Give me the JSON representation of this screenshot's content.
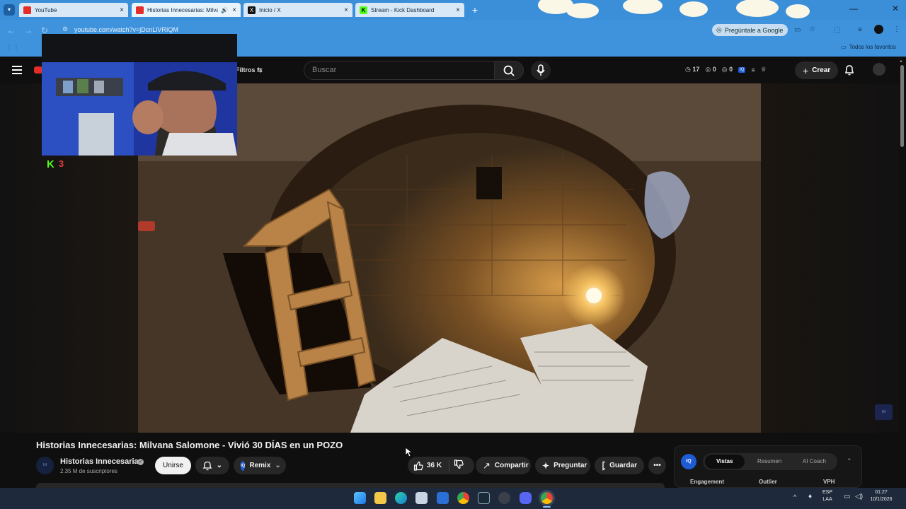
{
  "browser": {
    "tabs": [
      {
        "title": "YouTube",
        "icon": "youtube-icon",
        "active": false
      },
      {
        "title": "Historias Innecesarias: Milvana",
        "icon": "youtube-icon",
        "active": true
      },
      {
        "title": "Inicio / X",
        "icon": "x-icon",
        "active": false
      },
      {
        "title": "Stream - Kick Dashboard",
        "icon": "kick-icon",
        "active": false
      }
    ],
    "url": "youtube.com/watch?v=jDcnLlVRIQM",
    "ask_google": "Pregúntale a Google",
    "all_favorites": "Todos los favoritos"
  },
  "youtube": {
    "filters_label": "Filtros",
    "search_placeholder": "Buscar",
    "header_stats": {
      "a": "17",
      "b": "0",
      "c": "0"
    },
    "create_label": "Crear"
  },
  "overlay": {
    "kick_logo": "K",
    "kick_count": "3"
  },
  "video": {
    "title": "Historias Innecesarias: Milvana Salomone - Vivió 30 DÍAS en un POZO",
    "channel_name": "Historias Innecesarias",
    "subscribers": "2.35 M de suscriptores",
    "join_label": "Unirse",
    "remix_label": "Remix",
    "likes": "36 K",
    "share_label": "Compartir",
    "ask_label": "Preguntar",
    "save_label": "Guardar"
  },
  "panel": {
    "badge": "IQ",
    "tabs": [
      "Vistas",
      "Resumen",
      "AI Coach"
    ],
    "headers": [
      "Engagement",
      "Outlier",
      "VPH"
    ]
  },
  "tray": {
    "lang_top": "ESP",
    "lang_bottom": "LAA",
    "time": "01:27",
    "date": "10/1/2026"
  },
  "colors": {
    "tab_bar": "#3b8fd9",
    "youtube_bg": "#0f0f0f",
    "kick_green": "#53fc18",
    "taskbar": "#1e2a3c"
  }
}
